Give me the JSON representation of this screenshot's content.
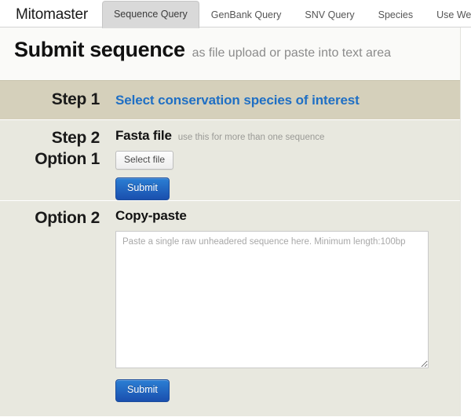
{
  "nav": {
    "brand": "Mitomaster",
    "tabs": [
      {
        "label": "Sequence Query",
        "active": true
      },
      {
        "label": "GenBank Query",
        "active": false
      },
      {
        "label": "SNV Query",
        "active": false
      },
      {
        "label": "Species",
        "active": false
      },
      {
        "label": "Use Web Service",
        "active": false
      }
    ]
  },
  "header": {
    "title": "Submit sequence",
    "subtitle": "as file upload or paste into text area"
  },
  "steps": {
    "step1": {
      "label": "Step 1",
      "link_label": "Select conservation species of interest",
      "link_color": "#1f6fc4"
    },
    "step2": {
      "label_line1": "Step 2",
      "label_line2": "Option 1",
      "section_title": "Fasta file",
      "section_hint": "use this for more than one sequence",
      "select_file_label": "Select file",
      "submit_label": "Submit"
    },
    "option2": {
      "label": "Option 2",
      "section_title": "Copy-paste",
      "textarea_value": "",
      "textarea_placeholder": "Paste a single raw unheadered sequence here. Minimum length:100bp",
      "submit_label": "Submit"
    }
  }
}
